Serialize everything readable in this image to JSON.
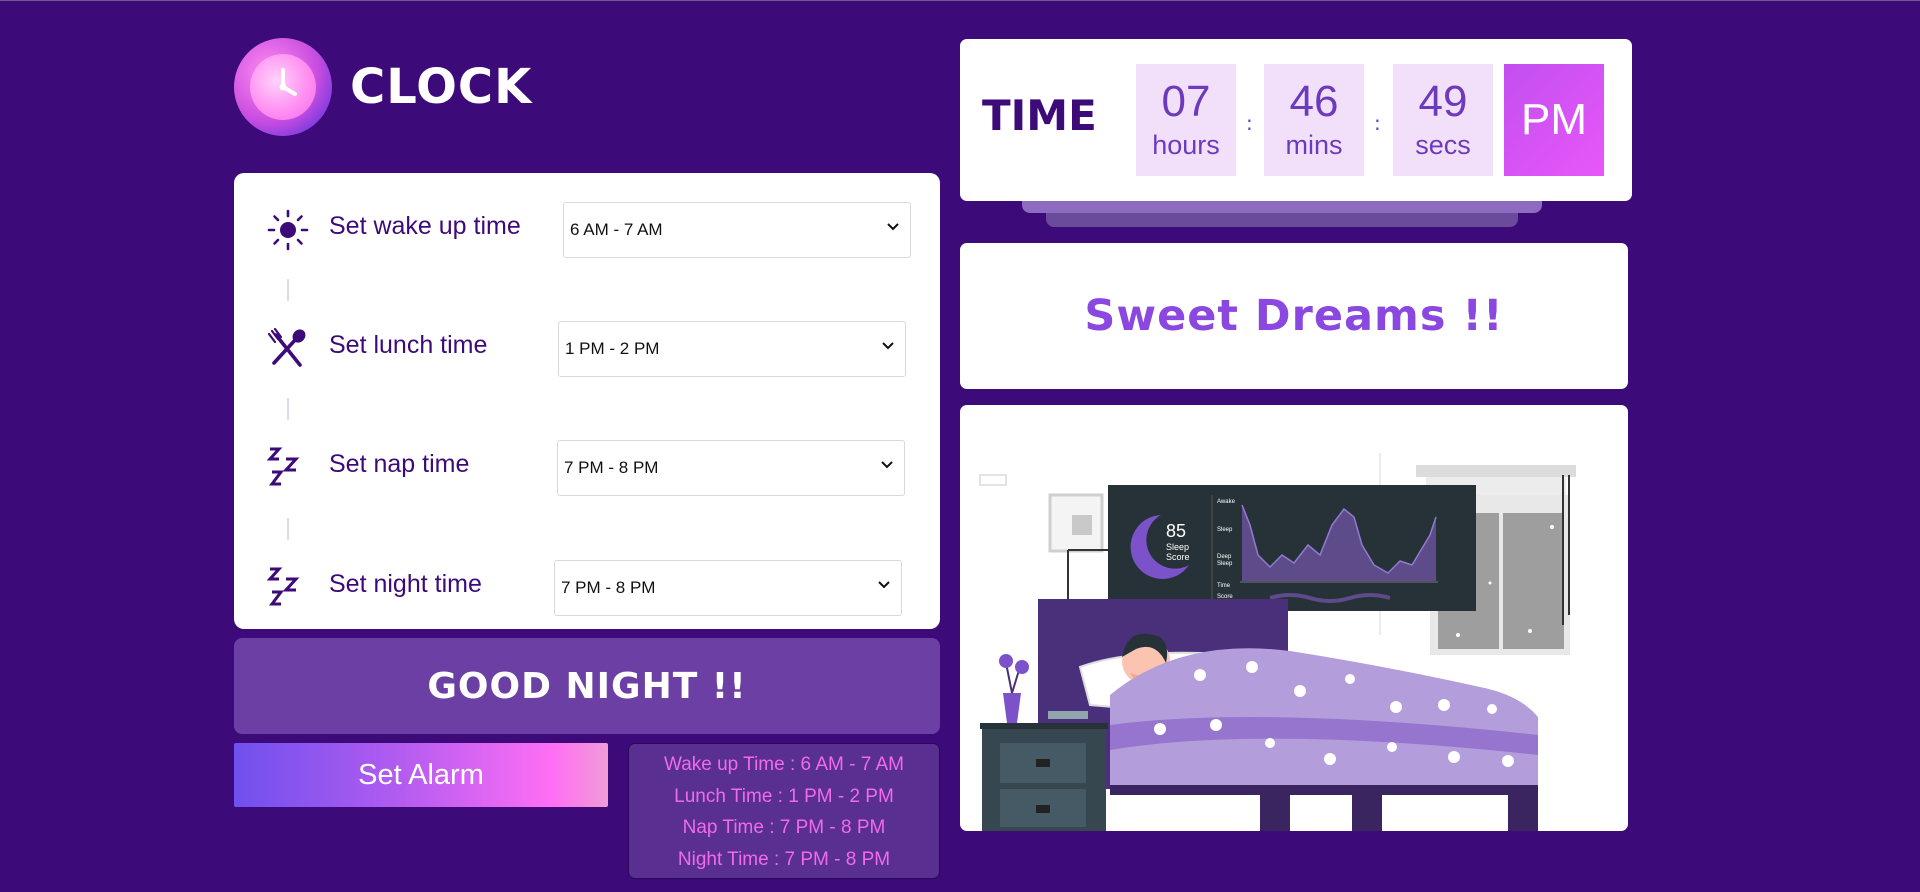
{
  "app": {
    "title": "CLOCK"
  },
  "schedule": [
    {
      "label": "Set wake up time",
      "value": "6 AM - 7 AM",
      "icon": "sun-icon"
    },
    {
      "label": "Set lunch time",
      "value": "1 PM - 2 PM",
      "icon": "fork-spoon-icon"
    },
    {
      "label": "Set nap time",
      "value": "7 PM - 8 PM",
      "icon": "zzz-icon"
    },
    {
      "label": "Set night time",
      "value": "7 PM - 8 PM",
      "icon": "zzz-icon"
    }
  ],
  "greeting": "GOOD NIGHT !!",
  "alarm_button": "Set Alarm",
  "summary": [
    "Wake up Time : 6 AM - 7 AM",
    "Lunch Time : 1 PM - 2 PM",
    "Nap Time : 7 PM - 8 PM",
    "Night Time : 7 PM - 8 PM"
  ],
  "clock": {
    "label": "TIME",
    "hours": "07",
    "hours_unit": "hours",
    "mins": "46",
    "mins_unit": "mins",
    "secs": "49",
    "secs_unit": "secs",
    "sep": ":",
    "ampm": "PM"
  },
  "message": "Sweet Dreams !!",
  "illustration": {
    "sleep_score": "85",
    "sleep_score_label_1": "Sleep",
    "sleep_score_label_2": "Score",
    "graph_labels": [
      "Awake",
      "Sleep",
      "Deep",
      "Sleep",
      "Time",
      "Score"
    ]
  },
  "colors": {
    "background": "#3d0a7a",
    "accent": "#8a48e0",
    "summary_text": "#f16be6",
    "greeting_bg": "#6b3fa3"
  }
}
